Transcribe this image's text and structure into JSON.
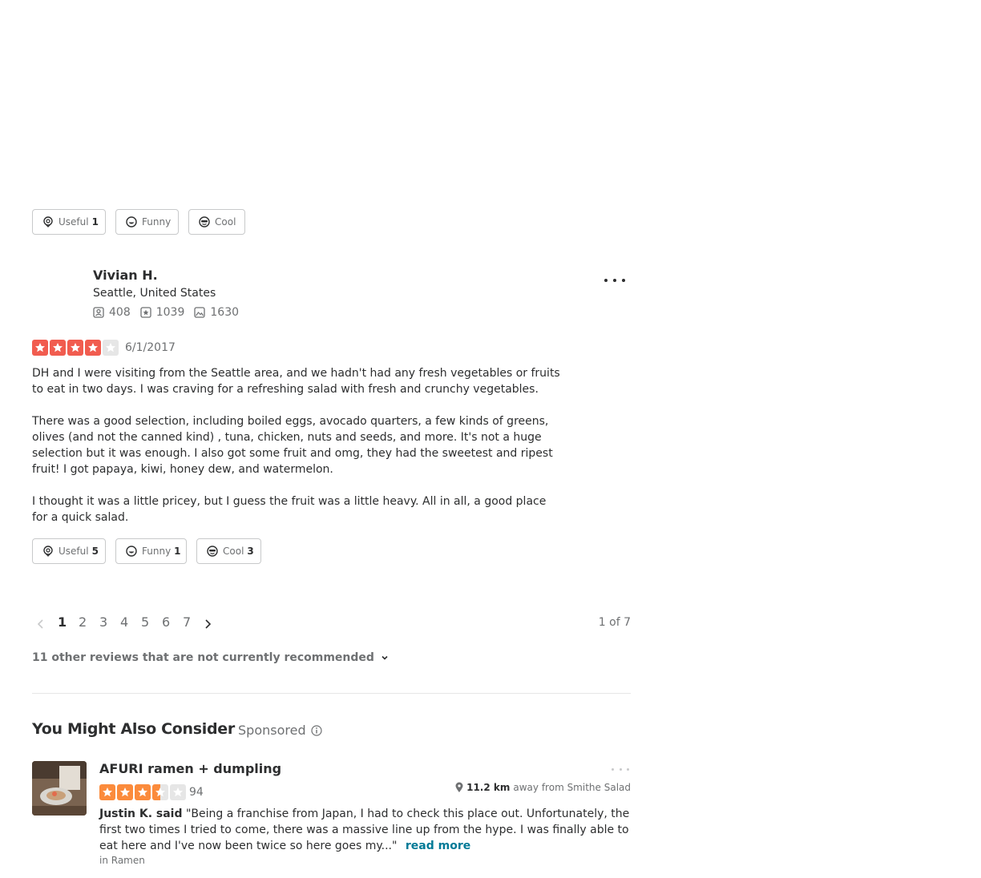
{
  "review1": {
    "reactions": [
      {
        "label": "Useful",
        "count": "1"
      },
      {
        "label": "Funny",
        "count": ""
      },
      {
        "label": "Cool",
        "count": ""
      }
    ]
  },
  "review2": {
    "user": {
      "name": "Vivian H.",
      "location": "Seattle, United States",
      "friends": "408",
      "reviews": "1039",
      "photos": "1630"
    },
    "rating": 4,
    "date": "6/1/2017",
    "paragraphs": [
      "DH and I were visiting from the Seattle area, and we hadn't had any fresh vegetables or fruits to eat in two days. I was craving for a refreshing salad with fresh and crunchy vegetables.",
      "There was a good selection, including boiled eggs, avocado quarters, a few kinds of greens, olives (and not the canned kind) , tuna, chicken, nuts and seeds, and more. It's not a huge selection but it was enough.  I also got some fruit and omg, they had the sweetest and ripest fruit! I got papaya, kiwi, honey dew, and watermelon.",
      "I thought it was a little pricey, but I guess the fruit was a little heavy.  All in all, a good place for a quick salad."
    ],
    "reactions": [
      {
        "label": "Useful",
        "count": "5"
      },
      {
        "label": "Funny",
        "count": "1"
      },
      {
        "label": "Cool",
        "count": "3"
      }
    ]
  },
  "pagination": {
    "pages": [
      "1",
      "2",
      "3",
      "4",
      "5",
      "6",
      "7"
    ],
    "current": "1",
    "summary": "1 of 7"
  },
  "not_recommended": "11 other reviews that are not currently recommended",
  "consider": {
    "heading": "You Might Also Consider",
    "sponsored": "Sponsored",
    "business": {
      "name": "AFURI ramen + dumpling",
      "rating": 3.5,
      "review_count": "94",
      "distance": "11.2 km",
      "distance_suffix": "away from Smithe Salad",
      "reviewer": "Justin K. said",
      "snippet": "\"Being a franchise from Japan, I had to check this place out. Unfortunately, the first two times I tried to come, there was a massive line up from the hype. I was finally able to eat here and I've now been twice so here goes my...\"",
      "read_more": "read more",
      "category": "in Ramen"
    }
  },
  "colors": {
    "star_red": "#f15c4f",
    "star_orange": "#fb8b3c",
    "star_empty": "#e6e6e6",
    "link_teal": "#027a97"
  }
}
